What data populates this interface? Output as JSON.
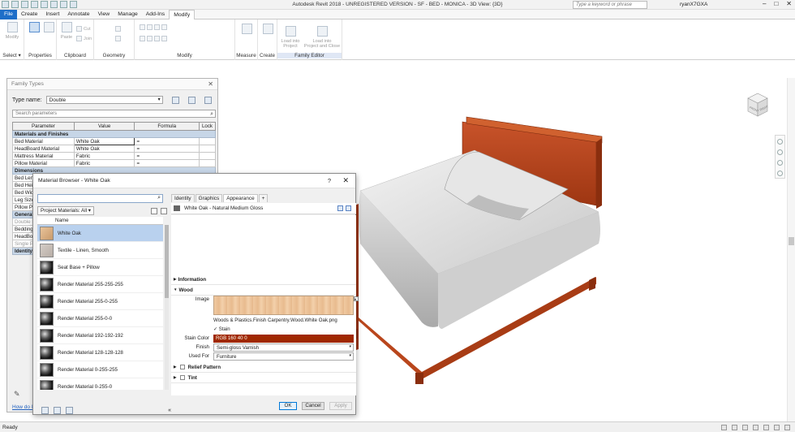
{
  "app": {
    "title": "Autodesk Revit 2018 - UNREGISTERED VERSION -   SF - BED - MONICA - 3D View: {3D}",
    "search_placeholder": "Type a keyword or phrase",
    "user": "ryanX7GXA"
  },
  "ribbon_tabs": [
    "File",
    "Create",
    "Insert",
    "Annotate",
    "View",
    "Manage",
    "Add-Ins",
    "Modify"
  ],
  "ribbon": {
    "modify_label": "Modify",
    "select_label": "Select ▾",
    "properties_label": "Properties",
    "clipboard": {
      "label": "Clipboard",
      "paste": "Paste",
      "cut": "Cut",
      "join": "Join"
    },
    "geometry_label": "Geometry",
    "modify_group_label": "Modify",
    "measure_label": "Measure",
    "create_label": "Create",
    "family_editor": {
      "label": "Family Editor",
      "load_project": "Load into\nProject",
      "load_close": "Load into\nProject and Close"
    }
  },
  "status": {
    "text": "Ready"
  },
  "family_types": {
    "title": "Family Types",
    "type_name_label": "Type name:",
    "type_name": "Double",
    "search_placeholder": "Search parameters",
    "headers": [
      "Parameter",
      "Value",
      "Formula",
      "Lock"
    ],
    "groups": [
      {
        "name": "Materials and Finishes"
      },
      {
        "name": "Dimensions"
      },
      {
        "name": "General"
      },
      {
        "name": "Identity"
      }
    ],
    "rows": [
      {
        "param": "Bed Material",
        "value": "White Oak",
        "formula": "="
      },
      {
        "param": "HeadBoard Material",
        "value": "White Oak",
        "formula": "="
      },
      {
        "param": "Mattress Material",
        "value": "Fabric",
        "formula": "="
      },
      {
        "param": "Pillow Material",
        "value": "Fabric",
        "formula": "="
      }
    ],
    "dim_rows": [
      "Bed Leng",
      "Bed Heig",
      "Bed Widt",
      "Leg Size",
      "Pillow Pe"
    ],
    "gen_rows": [
      "Double P",
      "Bedding",
      "HeadBo",
      "Single P"
    ],
    "how_do": "How do I"
  },
  "material_browser": {
    "title": "Material Browser - White Oak",
    "help": "?",
    "library_button": "Project Materials: All ▾",
    "list_header": "Name",
    "materials": [
      {
        "name": "White Oak",
        "swatch": "wood",
        "selected": true
      },
      {
        "name": "Textile - Linen, Smooth",
        "swatch": "linen"
      },
      {
        "name": "Seat Base + Pillow",
        "swatch": "sph"
      },
      {
        "name": "Render Material 255-255-255",
        "swatch": "sph"
      },
      {
        "name": "Render Material 255-0-255",
        "swatch": "sph"
      },
      {
        "name": "Render Material 255-0-0",
        "swatch": "sph"
      },
      {
        "name": "Render Material 192-192-192",
        "swatch": "sph"
      },
      {
        "name": "Render Material 128-128-128",
        "swatch": "sph"
      },
      {
        "name": "Render Material 0-255-255",
        "swatch": "sph"
      },
      {
        "name": "Render Material 0-255-0",
        "swatch": "sph"
      }
    ],
    "tabs": [
      "Identity",
      "Graphics",
      "Appearance",
      "+"
    ],
    "active_tab": "Appearance",
    "asset_name": "White Oak - Natural Medium Gloss",
    "sections": {
      "information": "Information",
      "wood": "Wood",
      "relief": "Relief Pattern",
      "tint": "Tint"
    },
    "image_label": "Image",
    "image_file": "Woods & Plastics.Finish Carpentry.Wood.White Oak.png",
    "stain_check": "✓  Stain",
    "stain_color_label": "Stain Color",
    "stain_color_value": "RGB 160 40 0",
    "stain_color_hex": "#a02800",
    "finish_label": "Finish",
    "finish_value": "Semi-gloss Varnish",
    "used_for_label": "Used For",
    "used_for_value": "Furniture",
    "buttons": {
      "ok": "OK",
      "cancel": "Cancel",
      "apply": "Apply"
    }
  },
  "viewcube": {
    "front": "FRONT",
    "right": "RIGHT"
  },
  "colors": {
    "accent": "#1e6ec8",
    "bed_wood": "#b9461c",
    "selection": "#b9d1ee"
  }
}
